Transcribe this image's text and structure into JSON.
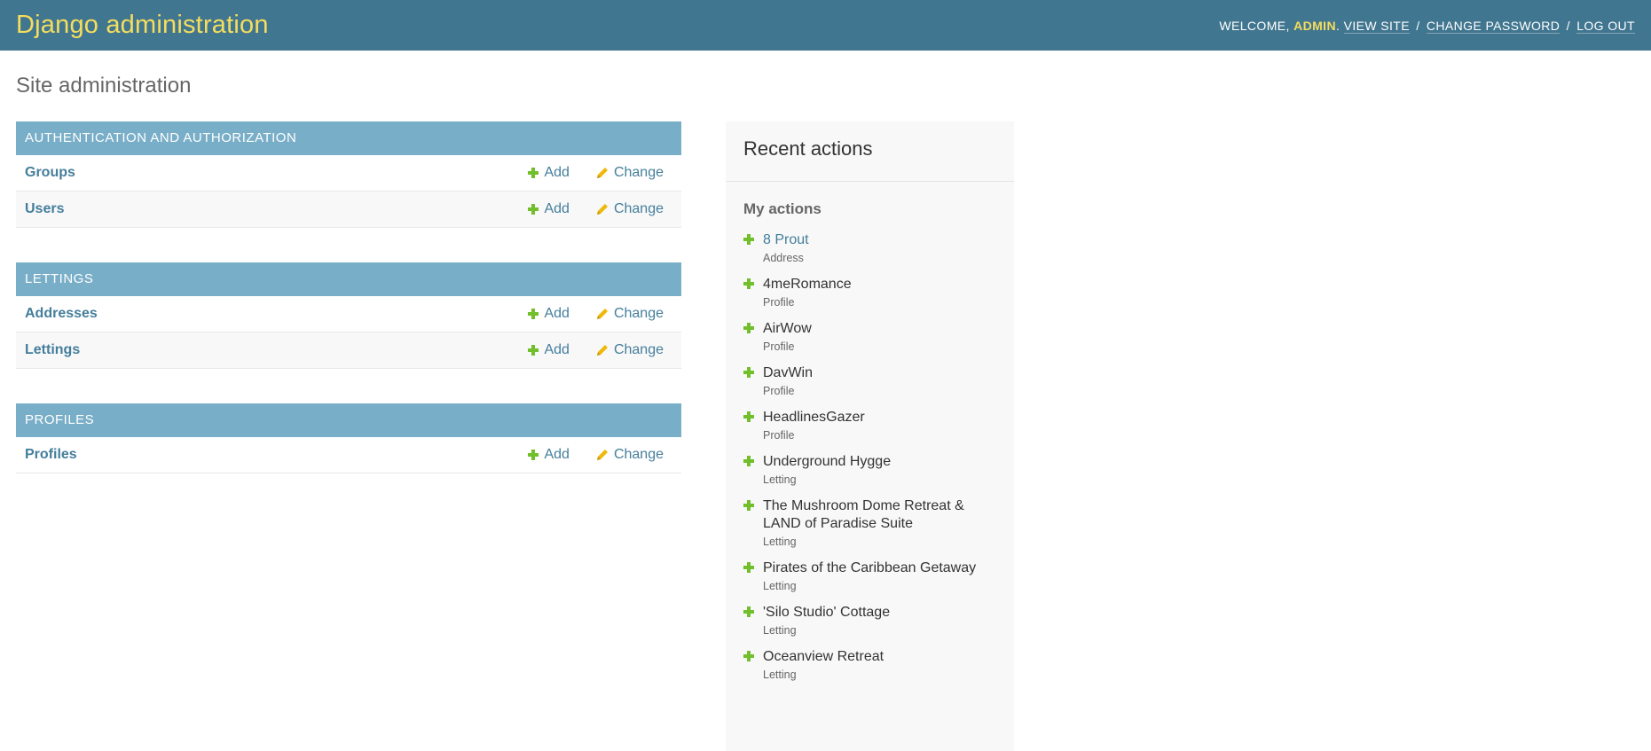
{
  "header": {
    "site_name": "Django administration",
    "welcome": "Welcome,",
    "user_name": "admin",
    "view_site": "View site",
    "change_password": "Change password",
    "log_out": "Log out"
  },
  "page": {
    "title": "Site administration"
  },
  "actions": {
    "add_label": "Add",
    "change_label": "Change"
  },
  "modules": [
    {
      "caption": "Authentication and Authorization",
      "models": [
        {
          "name": "Groups"
        },
        {
          "name": "Users"
        }
      ]
    },
    {
      "caption": "Lettings",
      "models": [
        {
          "name": "Addresses"
        },
        {
          "name": "Lettings"
        }
      ]
    },
    {
      "caption": "Profiles",
      "models": [
        {
          "name": "Profiles"
        }
      ]
    }
  ],
  "recent_actions": {
    "heading": "Recent actions",
    "subheading": "My actions",
    "items": [
      {
        "title": "8 Prout",
        "type": "Address"
      },
      {
        "title": "4meRomance",
        "type": "Profile"
      },
      {
        "title": "AirWow",
        "type": "Profile"
      },
      {
        "title": "DavWin",
        "type": "Profile"
      },
      {
        "title": "HeadlinesGazer",
        "type": "Profile"
      },
      {
        "title": "Underground Hygge",
        "type": "Letting"
      },
      {
        "title": "The Mushroom Dome Retreat & LAND of Paradise Suite",
        "type": "Letting"
      },
      {
        "title": "Pirates of the Caribbean Getaway",
        "type": "Letting"
      },
      {
        "title": "'Silo Studio' Cottage",
        "type": "Letting"
      },
      {
        "title": "Oceanview Retreat",
        "type": "Letting"
      }
    ]
  },
  "colors": {
    "header_bg": "#417690",
    "brand_yellow": "#f5dd5d",
    "module_caption_bg": "#79aec8",
    "link": "#447e9b",
    "add_green": "#70bf2b",
    "change_yellow": "#efb80b"
  }
}
